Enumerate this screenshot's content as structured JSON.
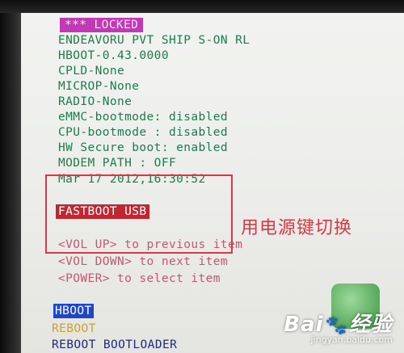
{
  "bootloader": {
    "status_badge": "*** LOCKED",
    "info_lines": [
      "ENDEAVORU PVT SHIP S-ON RL",
      "HBOOT-0.43.0000",
      "CPLD-None",
      "MICROP-None",
      "RADIO-None",
      "eMMC-bootmode: disabled",
      "CPU-bootmode : disabled",
      "HW Secure boot: enabled",
      "MODEM PATH : OFF",
      "Mar 17 2012,16:30:52"
    ],
    "mode_badge": "FASTBOOT USB",
    "instructions": [
      "<VOL UP> to previous item",
      "<VOL DOWN> to next item",
      "<POWER> to select item"
    ],
    "menu": [
      {
        "label": "HBOOT",
        "selected": true
      },
      {
        "label": "REBOOT",
        "selected": false
      },
      {
        "label": "REBOOT BOOTLOADER",
        "selected": false
      }
    ]
  },
  "annotation": {
    "text": "用电源键切换"
  },
  "watermark": {
    "brand_left": "Bai",
    "brand_right": "经验",
    "url": "jingyan.baidu.com"
  },
  "colors": {
    "info_text": "#1b7d4b",
    "locked_badge": "#c338b5",
    "fastboot_badge": "#c22631",
    "instruction_text": "#c2586e",
    "selected_item": "#1f46c9",
    "reboot_item": "#caa12e",
    "annotation_red": "#d93846"
  }
}
